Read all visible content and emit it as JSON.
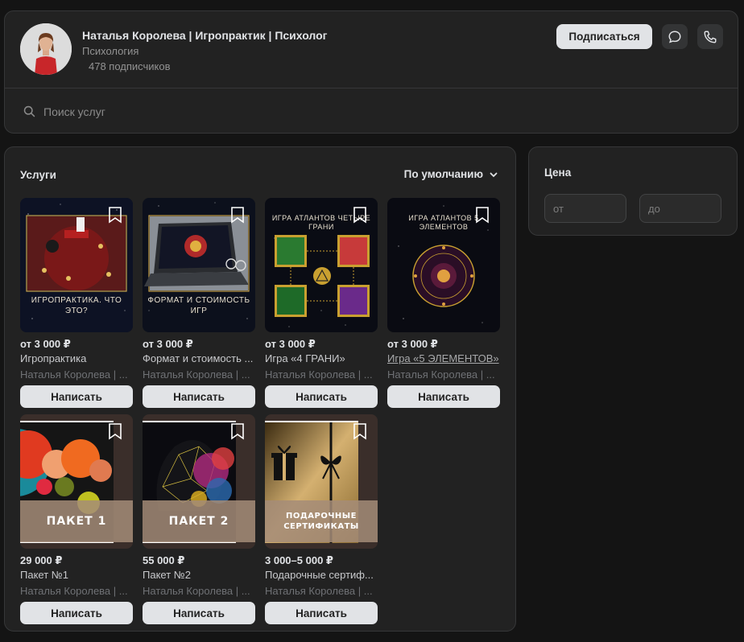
{
  "header": {
    "title": "Наталья Королева | Игропрактик | Психолог",
    "category": "Психология",
    "followers": "478 подписчиков",
    "subscribe_label": "Подписаться",
    "search_placeholder": "Поиск услуг"
  },
  "services": {
    "title": "Услуги",
    "sort_label": "По умолчанию",
    "items": [
      {
        "price": "от 3 000 ₽",
        "name": "Игропрактика",
        "seller": "Наталья Королева | ...",
        "button": "Написать",
        "thumb_text": "ИГРОПРАКТИКА. ЧТО ЭТО?"
      },
      {
        "price": "от 3 000 ₽",
        "name": "Формат и стоимость ...",
        "seller": "Наталья Королева | ...",
        "button": "Написать",
        "thumb_text": "ФОРМАТ И СТОИМОСТЬ ИГР"
      },
      {
        "price": "от 3 000 ₽",
        "name": "Игра «4 ГРАНИ»",
        "seller": "Наталья Королева | ...",
        "button": "Написать",
        "thumb_text": "ИГРА АТЛАНТОВ ЧЕТЫРЕ ГРАНИ"
      },
      {
        "price": "от 3 000 ₽",
        "name": "Игра «5 ЭЛЕМЕНТОВ»",
        "seller": "Наталья Королева | ...",
        "button": "Написать",
        "thumb_text": "ИГРА АТЛАНТОВ 5 ЭЛЕМЕНТОВ"
      },
      {
        "price": "29 000 ₽",
        "name": "Пакет №1",
        "seller": "Наталья Королева | ...",
        "button": "Написать",
        "thumb_text": "ПАКЕТ 1"
      },
      {
        "price": "55 000 ₽",
        "name": "Пакет №2",
        "seller": "Наталья Королева | ...",
        "button": "Написать",
        "thumb_text": "ПАКЕТ 2"
      },
      {
        "price": "3 000–5 000 ₽",
        "name": "Подарочные сертиф...",
        "seller": "Наталья Королева | ...",
        "button": "Написать",
        "thumb_text": "ПОДАРОЧНЫЕ СЕРТИФИКАТЫ"
      }
    ]
  },
  "price_filter": {
    "title": "Цена",
    "from_placeholder": "от",
    "to_placeholder": "до"
  },
  "icons": {
    "message": "message-icon",
    "phone": "phone-icon",
    "search": "search-icon",
    "bookmark": "bookmark-icon",
    "chevron": "chevron-down-icon"
  }
}
